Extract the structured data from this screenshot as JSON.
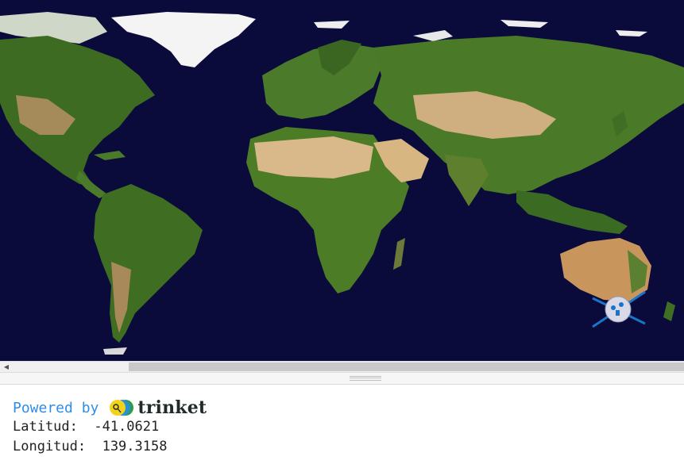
{
  "console": {
    "powered_by": "Powered by",
    "brand": "trinket",
    "lines": [
      "Latitud:  -41.0621",
      "Longitud:  139.3158"
    ]
  },
  "colors": {
    "ocean": "#0b0b3b",
    "accent": "#2f8de4",
    "marker": "#1a75c9"
  },
  "icons": {
    "marker": "iss-satellite-icon",
    "scroll_left": "arrow-left-icon",
    "logo": "trinket-logo-icon"
  }
}
